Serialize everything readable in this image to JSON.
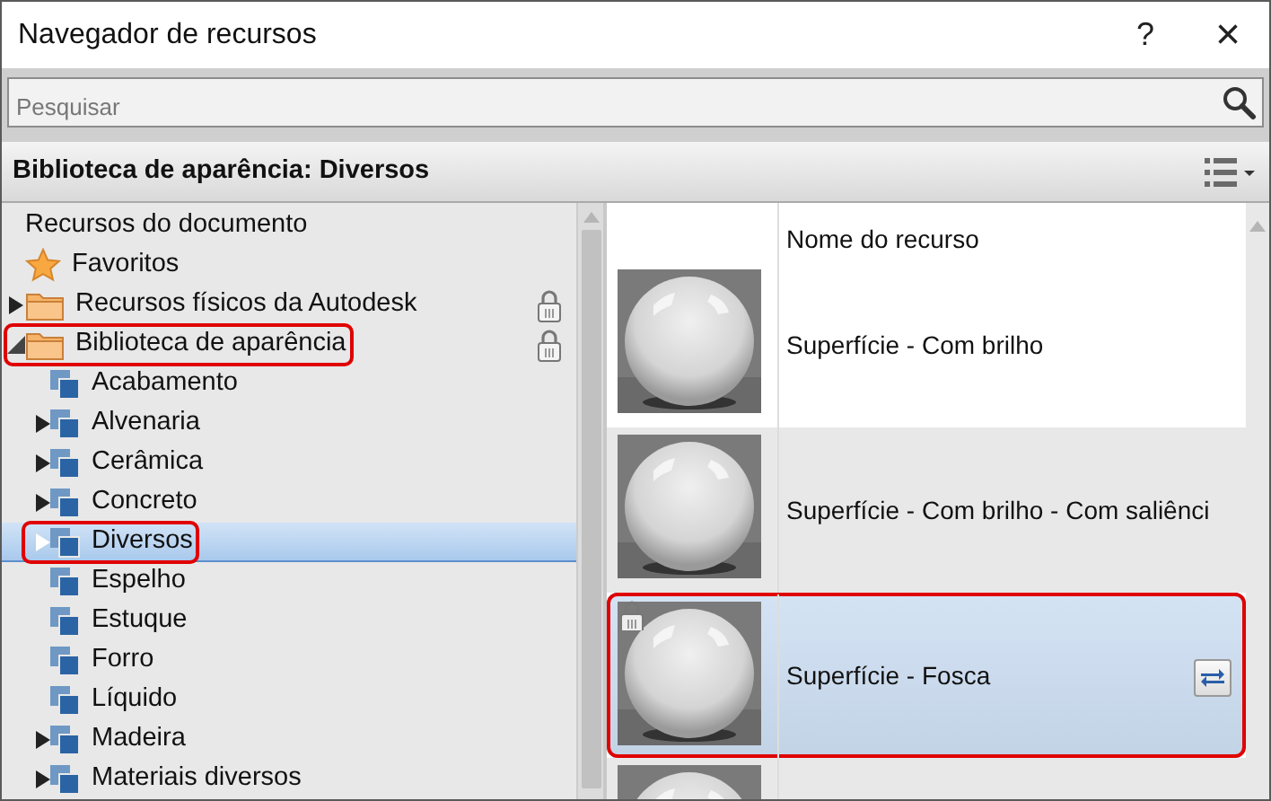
{
  "window": {
    "title": "Navegador de recursos",
    "help": "?",
    "close": "×"
  },
  "search": {
    "placeholder": "Pesquisar"
  },
  "header": {
    "title": "Biblioteca de aparência: Diversos"
  },
  "tree": [
    {
      "label": "Recursos do documento",
      "kind": "heading",
      "locked": false,
      "selected": false,
      "highlighted": false
    },
    {
      "label": "Favoritos",
      "kind": "favorites",
      "locked": false,
      "selected": false,
      "highlighted": false
    },
    {
      "label": "Recursos físicos da Autodesk",
      "kind": "folder",
      "expanded": false,
      "locked": true,
      "selected": false,
      "highlighted": false
    },
    {
      "label": "Biblioteca de aparência",
      "kind": "folder",
      "expanded": true,
      "locked": true,
      "selected": false,
      "highlighted": true,
      "children": [
        {
          "label": "Acabamento",
          "kind": "leaf",
          "selected": false,
          "highlighted": false
        },
        {
          "label": "Alvenaria",
          "kind": "branch",
          "selected": false,
          "highlighted": false
        },
        {
          "label": "Cerâmica",
          "kind": "branch",
          "selected": false,
          "highlighted": false
        },
        {
          "label": "Concreto",
          "kind": "branch",
          "selected": false,
          "highlighted": false
        },
        {
          "label": "Diversos",
          "kind": "branch",
          "selected": true,
          "highlighted": true
        },
        {
          "label": "Espelho",
          "kind": "leaf",
          "selected": false,
          "highlighted": false
        },
        {
          "label": "Estuque",
          "kind": "leaf",
          "selected": false,
          "highlighted": false
        },
        {
          "label": "Forro",
          "kind": "leaf",
          "selected": false,
          "highlighted": false
        },
        {
          "label": "Líquido",
          "kind": "leaf",
          "selected": false,
          "highlighted": false
        },
        {
          "label": "Madeira",
          "kind": "branch",
          "selected": false,
          "highlighted": false
        },
        {
          "label": "Materiais diversos",
          "kind": "branch",
          "selected": false,
          "highlighted": false
        }
      ]
    }
  ],
  "assets": {
    "column": "Nome do recurso",
    "rows": [
      {
        "name": "Superfície - Com brilho",
        "kind": "picture",
        "selected": false,
        "locked": false,
        "highlighted": false
      },
      {
        "name": "Superfície - Com brilho - Com saliênci",
        "kind": "picture",
        "selected": false,
        "locked": false,
        "highlighted": false
      },
      {
        "name": "Superfície - Fosca",
        "kind": "picture",
        "selected": true,
        "locked": true,
        "highlighted": true
      },
      {
        "kind": "picture",
        "selected": false,
        "locked": false,
        "highlighted": false
      }
    ]
  }
}
